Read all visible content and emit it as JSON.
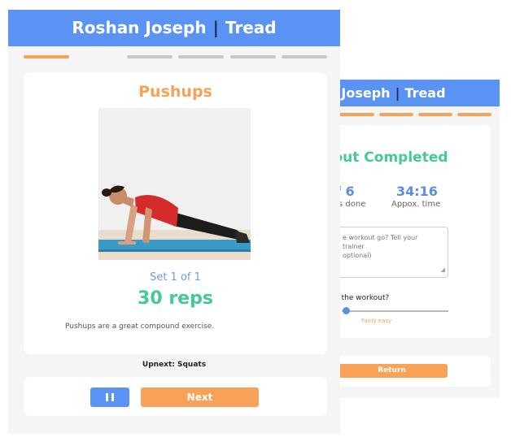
{
  "colors": {
    "primary_blue": "#5b93f5",
    "accent_orange": "#f7a256",
    "success_green": "#45c996",
    "stat_blue": "#5b8ce8",
    "panel_bg": "#f5f5f5"
  },
  "back_screen": {
    "header": {
      "name": "n Joseph",
      "separator": "|",
      "app": "Tread"
    },
    "title": "out Completed",
    "stats": [
      {
        "value": "f 6",
        "label": "s done"
      },
      {
        "value": "34:16",
        "label": "Appox. time"
      }
    ],
    "feedback": {
      "placeholder_line1": "e workout go? Tell your trainer",
      "placeholder_line2": "optional)"
    },
    "difficulty": {
      "question": "/ hard was the workout?",
      "value_label": "Fairly easy",
      "level": 0.02
    },
    "return_label": "Return"
  },
  "front_screen": {
    "header": {
      "name": "Roshan Joseph",
      "separator": "|",
      "app": "Tread"
    },
    "progress_icons": [
      "active",
      "next",
      "pending",
      "pending",
      "pending",
      "pending"
    ],
    "exercise": {
      "title": "Pushups",
      "photo_icon": "pushup-figure",
      "set_label": "Set 1 of 1",
      "reps": "30 reps",
      "description": "Pushups are a great compound exercise."
    },
    "upnext": "Upnext:  Squats",
    "pause_icon": "pause-icon",
    "next_label": "Next"
  }
}
